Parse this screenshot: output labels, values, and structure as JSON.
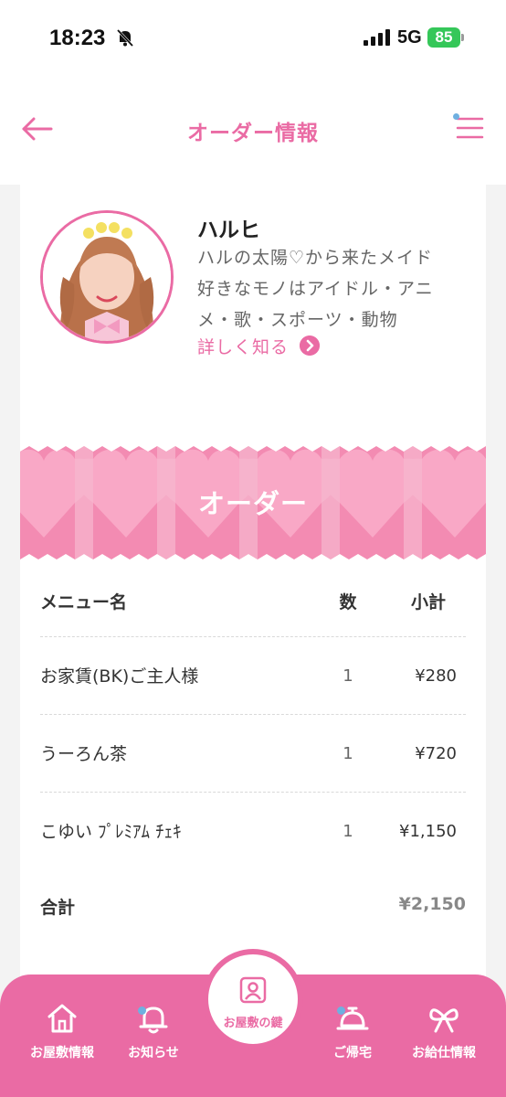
{
  "status_bar": {
    "time": "18:23",
    "network": "5G",
    "battery": "85",
    "icons": [
      "bell-off-icon",
      "signal-icon"
    ]
  },
  "header": {
    "title": "オーダー情報",
    "back_icon": "back-arrow-icon",
    "menu_icon": "hamburger-menu-icon"
  },
  "profile": {
    "name": "ハルヒ",
    "bio_lines": [
      "ハルの太陽♡から来たメイド",
      "好きなモノはアイドル・アニ",
      "メ・歌・スポーツ・動物"
    ],
    "detail_link": "詳しく知る"
  },
  "banner": {
    "title": "オーダー"
  },
  "order_table": {
    "headers": {
      "name": "メニュー名",
      "qty": "数",
      "subtotal": "小計"
    },
    "rows": [
      {
        "name": "お家賃(BK)ご主人様",
        "qty": "1",
        "subtotal": "¥280"
      },
      {
        "name": "うーろん茶",
        "qty": "1",
        "subtotal": "¥720"
      },
      {
        "name": "こゆい ﾌﾟﾚﾐｱﾑ ﾁｪｷ",
        "qty": "1",
        "subtotal": "¥1,150"
      }
    ],
    "total_label": "合計",
    "total_value": "¥2,150"
  },
  "bottom_nav": {
    "items": [
      {
        "label": "お屋敷情報",
        "icon": "home-icon"
      },
      {
        "label": "お知らせ",
        "icon": "bell-icon"
      },
      {
        "label": "お屋敷の鍵",
        "icon": "key-card-icon"
      },
      {
        "label": "ご帰宅",
        "icon": "bell-desk-icon"
      },
      {
        "label": "お給仕情報",
        "icon": "bow-icon"
      }
    ]
  },
  "colors": {
    "accent": "#ea6ba4",
    "banner_pink": "#f38bb2",
    "banner_light": "#f9b6cf",
    "dot_blue": "#6fb0e0",
    "battery_green": "#35c759"
  }
}
